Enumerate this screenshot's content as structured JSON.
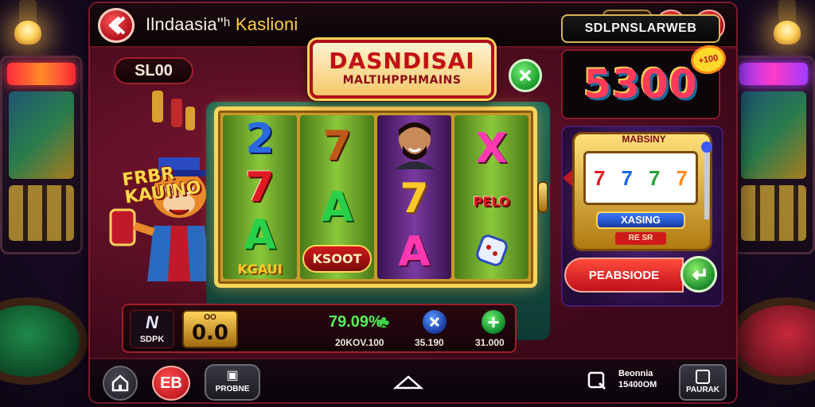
{
  "app": {
    "title_part1": "Ilndaasia\"ʰ",
    "title_part2": "Kaslioni"
  },
  "colors": {
    "frame": "#5a0f22",
    "accent_red": "#c0101a",
    "accent_gold": "#ffd45a",
    "accent_green": "#2aa03a"
  },
  "topbar": {
    "back_icon": "back-arrow-icon",
    "share_icon": "share-icon",
    "home_icon": "home-icon",
    "right_buttons": [
      "menu-icon",
      "store-icon"
    ]
  },
  "balance": {
    "label": "SL00"
  },
  "mascot": {
    "text_line1": "FRBR",
    "text_line2": "KAUINO"
  },
  "logo": {
    "line1": "DASNDISAI",
    "line2": "MALTIHPPHMAINS"
  },
  "reels": {
    "col1": [
      "2",
      "7",
      "A"
    ],
    "col1_tag": "KGAUI",
    "col2": [
      "7",
      "A"
    ],
    "col2_tag": "KSOOT",
    "col3": [
      "7",
      "A"
    ],
    "col4": [
      "X"
    ],
    "col4_tag": "PELO"
  },
  "right_panel": {
    "header": "SDLPNSLARWEB",
    "win_value": "5300",
    "win_badge": "+100",
    "mini_title": "MABSINY",
    "mini_label": "XASING",
    "mini_sub": "RE SR",
    "mini_symbols": [
      "7",
      "7",
      "7",
      "7"
    ],
    "promo_button": "PEABSIODE"
  },
  "bet_bar": {
    "logo_mark": "N",
    "logo_label": "SDPK",
    "bet_small": "OO",
    "bet_value": "0.0",
    "win_pct": "79.09%",
    "win_sub": "20KOV.100",
    "auto_value": "35.190",
    "plus_value": "31.000"
  },
  "bottombar": {
    "promo_label": "PROBNE",
    "red_label": "EB",
    "balance_line1": "Beonnia",
    "balance_line2": "15400OM",
    "menu_label": "PAURAK"
  }
}
